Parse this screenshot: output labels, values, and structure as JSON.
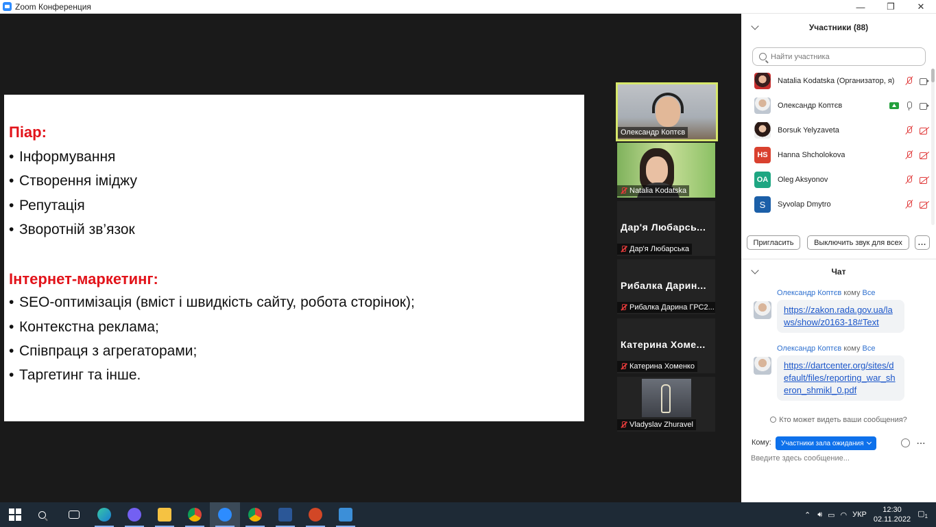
{
  "window": {
    "title": "Zoom Конференция",
    "minimize": "—",
    "maximize": "❐",
    "close": "✕"
  },
  "slide": {
    "heading1": "Піар:",
    "list1": [
      "Інформування",
      "Створення іміджу",
      "Репутація",
      "Зворотній зв’язок"
    ],
    "heading2": "Інтернет-маркетинг:",
    "list2": [
      "SEO-оптимізація (вміст і швидкість сайту, робота сторінок);",
      "Контекстна реклама;",
      "Співпраця з агрегаторами;",
      "Таргетинг та інше."
    ],
    "bullet": "•"
  },
  "videos": [
    {
      "name": "Олександр Коптєв"
    },
    {
      "name": "Natalia Kodatska"
    },
    {
      "big_name": "Дар'я Любарсь...",
      "name": "Дар'я Любарська"
    },
    {
      "big_name": "Рибалка Дарин...",
      "name": "Рибалка Дарина ГРС2..."
    },
    {
      "big_name": "Катерина Хоме...",
      "name": "Катерина Хоменко"
    },
    {
      "name": "Vladyslav Zhuravel"
    }
  ],
  "participants_panel": {
    "title": "Участники (88)",
    "search_placeholder": "Найти участника",
    "participants": [
      {
        "name": "Natalia Kodatska (Организатор, я)",
        "avatar": "",
        "avatar_color": ""
      },
      {
        "name": "Олександр Коптєв",
        "avatar": "",
        "avatar_color": ""
      },
      {
        "name": "Borsuk Yelyzaveta",
        "avatar": "",
        "avatar_color": ""
      },
      {
        "name": "Hanna Shcholokova",
        "avatar": "HS",
        "avatar_color": "#d9412f"
      },
      {
        "name": "Oleg Aksyonov",
        "avatar": "OA",
        "avatar_color": "#1ea682"
      },
      {
        "name": "Syvolap Dmytro",
        "avatar": "S",
        "avatar_color": "#1b5fa8"
      }
    ],
    "invite_label": "Пригласить",
    "mute_all_label": "Выключить звук для всех",
    "more_label": "..."
  },
  "chat": {
    "title": "Чат",
    "messages": [
      {
        "sender": "Олександр Коптєв",
        "to_word": "кому",
        "recipient": "Все",
        "link": "https://zakon.rada.gov.ua/laws/show/z0163-18#Text"
      },
      {
        "sender": "Олександр Коптєв",
        "to_word": "кому",
        "recipient": "Все",
        "link": "https://dartcenter.org/sites/default/files/reporting_war_sheron_shmikl_0.pdf"
      }
    ],
    "who_can_see": "Кто может видеть ваши сообщения?",
    "to_label": "Кому:",
    "to_value": "Участники зала ожидания",
    "input_placeholder": "Введите здесь сообщение...",
    "more_label": "..."
  },
  "taskbar": {
    "language": "УКР",
    "time": "12:30",
    "date": "02.11.2022",
    "notifications": "1"
  },
  "colors": {
    "accent": "#0e71eb",
    "slide_heading": "#e2131a",
    "active_speaker_border": "#d6e76b"
  }
}
